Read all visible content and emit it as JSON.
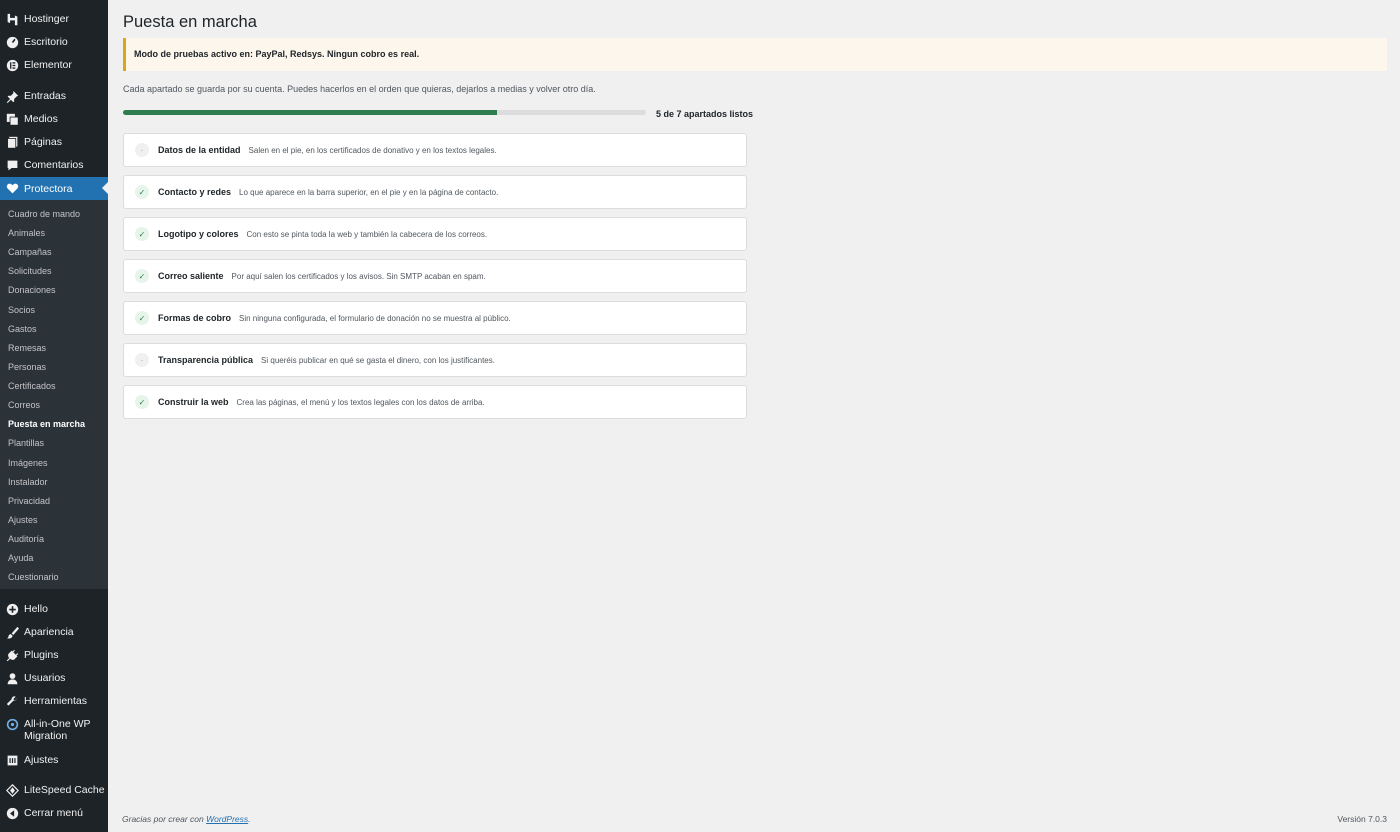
{
  "sidebar": {
    "top_items": [
      {
        "label": "Hostinger",
        "icon": "hostinger-icon"
      },
      {
        "label": "Escritorio",
        "icon": "dashboard-icon"
      },
      {
        "label": "Elementor",
        "icon": "elementor-icon"
      },
      {
        "label": "Entradas",
        "icon": "pin-icon"
      },
      {
        "label": "Medios",
        "icon": "media-icon"
      },
      {
        "label": "Páginas",
        "icon": "pages-icon"
      },
      {
        "label": "Comentarios",
        "icon": "comments-icon"
      },
      {
        "label": "Protectora",
        "icon": "heart-icon"
      }
    ],
    "submenu": [
      "Cuadro de mando",
      "Animales",
      "Campañas",
      "Solicitudes",
      "Donaciones",
      "Socios",
      "Gastos",
      "Remesas",
      "Personas",
      "Certificados",
      "Correos",
      "Puesta en marcha",
      "Plantillas",
      "Imágenes",
      "Instalador",
      "Privacidad",
      "Ajustes",
      "Auditoría",
      "Ayuda",
      "Cuestionario"
    ],
    "bottom_items": [
      {
        "label": "Hello",
        "icon": "plus-circle-icon"
      },
      {
        "label": "Apariencia",
        "icon": "brush-icon"
      },
      {
        "label": "Plugins",
        "icon": "plug-icon"
      },
      {
        "label": "Usuarios",
        "icon": "user-icon"
      },
      {
        "label": "Herramientas",
        "icon": "wrench-icon"
      },
      {
        "label": "All-in-One WP",
        "label2": "Migration",
        "icon": "migration-icon"
      },
      {
        "label": "Ajustes",
        "icon": "settings-icon"
      },
      {
        "label": "LiteSpeed Cache",
        "icon": "litespeed-icon"
      },
      {
        "label": "Cerrar menú",
        "icon": "collapse-icon"
      }
    ]
  },
  "main": {
    "title": "Puesta en marcha",
    "notice": "Modo de pruebas activo en: PayPal, Redsys. Ningun cobro es real.",
    "intro": "Cada apartado se guarda por su cuenta. Puedes hacerlos en el orden que quieras, dejarlos a medias y volver otro día.",
    "progress": {
      "completed": 5,
      "total": 7,
      "text": "5 de 7 apartados listos"
    },
    "sections": [
      {
        "title": "Datos de la entidad",
        "desc": "Salen en el pie, en los certificados de donativo y en los textos legales.",
        "status": "pending",
        "mark": "·"
      },
      {
        "title": "Contacto y redes",
        "desc": "Lo que aparece en la barra superior, en el pie y en la página de contacto.",
        "status": "done",
        "mark": "✓"
      },
      {
        "title": "Logotipo y colores",
        "desc": "Con esto se pinta toda la web y también la cabecera de los correos.",
        "status": "done",
        "mark": "✓"
      },
      {
        "title": "Correo saliente",
        "desc": "Por aquí salen los certificados y los avisos. Sin SMTP acaban en spam.",
        "status": "done",
        "mark": "✓"
      },
      {
        "title": "Formas de cobro",
        "desc": "Sin ninguna configurada, el formulario de donación no se muestra al público.",
        "status": "done",
        "mark": "✓"
      },
      {
        "title": "Transparencia pública",
        "desc": "Si queréis publicar en qué se gasta el dinero, con los justificantes.",
        "status": "pending",
        "mark": "·"
      },
      {
        "title": "Construir la web",
        "desc": "Crea las páginas, el menú y los textos legales con los datos de arriba.",
        "status": "done",
        "mark": "✓"
      }
    ]
  },
  "footer": {
    "thanks_prefix": "Gracias por crear con ",
    "thanks_link": "WordPress",
    "thanks_suffix": ".",
    "version": "Versión 7.0.3"
  },
  "colors": {
    "accent": "#2271b1",
    "sidebar": "#1d2327",
    "progress": "#2e7d4f",
    "notice_border": "#dba617"
  }
}
